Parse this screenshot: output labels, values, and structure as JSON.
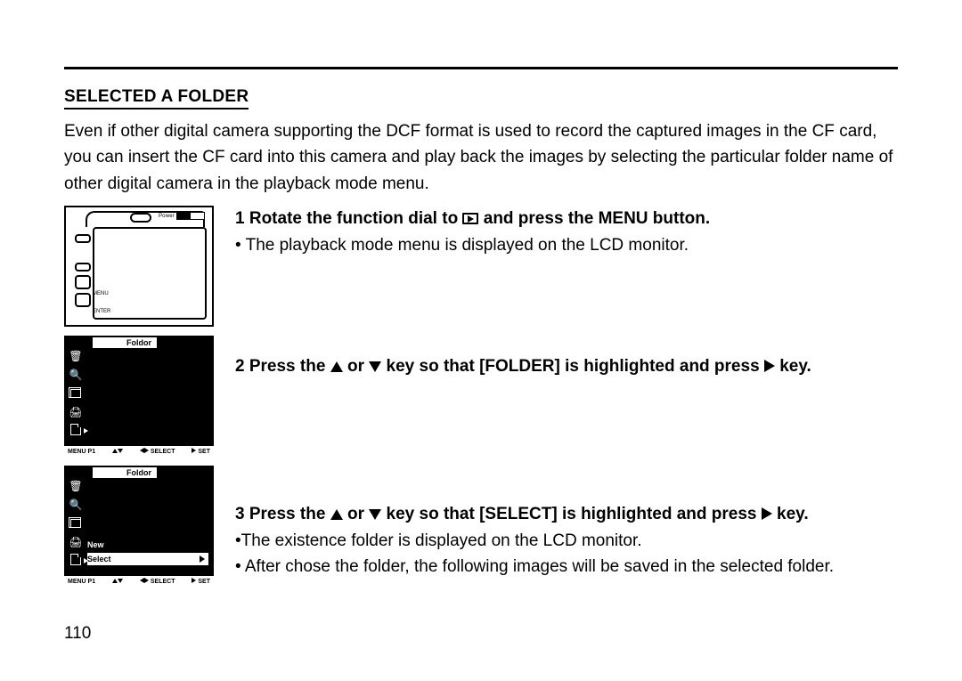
{
  "section_title": "SELECTED A FOLDER",
  "intro": "Even if other digital camera supporting the DCF format is used to record the captured images in the CF card, you can insert the CF card into this camera and play back the images by selecting the partic­ular folder name of other digital camera in the playback mode menu.",
  "steps": {
    "s1": {
      "num": "1",
      "head_a": "Rotate the function dial to ",
      "head_b": " and press the MENU button.",
      "bullet1": "• The playback mode menu is displayed on the LCD monitor."
    },
    "s2": {
      "num": "2",
      "head_a": "Press the ",
      "head_b": " or ",
      "head_c": "  key so that [FOLDER] is highlighted and press ",
      "head_d": "  key."
    },
    "s3": {
      "num": "3",
      "head_a": "Press the ",
      "head_b": " or ",
      "head_c": "  key so that [SELECT] is highlighted and press ",
      "head_d": "  key.",
      "bullet1": "•The existence folder is displayed on the LCD monitor.",
      "bullet2": "• After chose the folder, the following images will be saved in the selected fold­er."
    }
  },
  "camera": {
    "power": "Power",
    "lbl_card": "",
    "lbl_menu": "MENU",
    "lbl_enter": "ENTER"
  },
  "lcd1": {
    "title": "Foldor",
    "bar_menu": "MENU P1",
    "bar_select": "SELECT",
    "bar_set": "SET"
  },
  "lcd2": {
    "title": "Foldor",
    "row_new": "New",
    "row_select": "Select",
    "bar_menu": "MENU P1",
    "bar_select": "SELECT",
    "bar_set": "SET"
  },
  "page_number": "110"
}
